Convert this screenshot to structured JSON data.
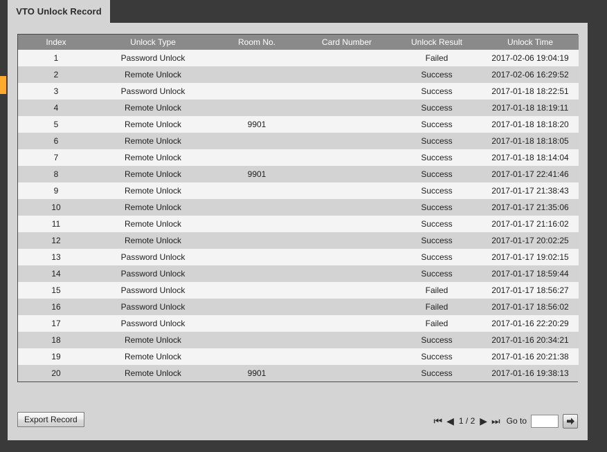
{
  "window": {
    "tab_label": "VTO Unlock Record"
  },
  "table": {
    "columns": [
      "Index",
      "Unlock Type",
      "Room No.",
      "Card Number",
      "Unlock Result",
      "Unlock Time"
    ],
    "rows": [
      {
        "index": "1",
        "unlock_type": "Password Unlock",
        "room_no": "",
        "card_number": "",
        "unlock_result": "Failed",
        "unlock_time": "2017-02-06 19:04:19"
      },
      {
        "index": "2",
        "unlock_type": "Remote Unlock",
        "room_no": "",
        "card_number": "",
        "unlock_result": "Success",
        "unlock_time": "2017-02-06 16:29:52"
      },
      {
        "index": "3",
        "unlock_type": "Password Unlock",
        "room_no": "",
        "card_number": "",
        "unlock_result": "Success",
        "unlock_time": "2017-01-18 18:22:51"
      },
      {
        "index": "4",
        "unlock_type": "Remote Unlock",
        "room_no": "",
        "card_number": "",
        "unlock_result": "Success",
        "unlock_time": "2017-01-18 18:19:11"
      },
      {
        "index": "5",
        "unlock_type": "Remote Unlock",
        "room_no": "9901",
        "card_number": "",
        "unlock_result": "Success",
        "unlock_time": "2017-01-18 18:18:20"
      },
      {
        "index": "6",
        "unlock_type": "Remote Unlock",
        "room_no": "",
        "card_number": "",
        "unlock_result": "Success",
        "unlock_time": "2017-01-18 18:18:05"
      },
      {
        "index": "7",
        "unlock_type": "Remote Unlock",
        "room_no": "",
        "card_number": "",
        "unlock_result": "Success",
        "unlock_time": "2017-01-18 18:14:04"
      },
      {
        "index": "8",
        "unlock_type": "Remote Unlock",
        "room_no": "9901",
        "card_number": "",
        "unlock_result": "Success",
        "unlock_time": "2017-01-17 22:41:46"
      },
      {
        "index": "9",
        "unlock_type": "Remote Unlock",
        "room_no": "",
        "card_number": "",
        "unlock_result": "Success",
        "unlock_time": "2017-01-17 21:38:43"
      },
      {
        "index": "10",
        "unlock_type": "Remote Unlock",
        "room_no": "",
        "card_number": "",
        "unlock_result": "Success",
        "unlock_time": "2017-01-17 21:35:06"
      },
      {
        "index": "11",
        "unlock_type": "Remote Unlock",
        "room_no": "",
        "card_number": "",
        "unlock_result": "Success",
        "unlock_time": "2017-01-17 21:16:02"
      },
      {
        "index": "12",
        "unlock_type": "Remote Unlock",
        "room_no": "",
        "card_number": "",
        "unlock_result": "Success",
        "unlock_time": "2017-01-17 20:02:25"
      },
      {
        "index": "13",
        "unlock_type": "Password Unlock",
        "room_no": "",
        "card_number": "",
        "unlock_result": "Success",
        "unlock_time": "2017-01-17 19:02:15"
      },
      {
        "index": "14",
        "unlock_type": "Password Unlock",
        "room_no": "",
        "card_number": "",
        "unlock_result": "Success",
        "unlock_time": "2017-01-17 18:59:44"
      },
      {
        "index": "15",
        "unlock_type": "Password Unlock",
        "room_no": "",
        "card_number": "",
        "unlock_result": "Failed",
        "unlock_time": "2017-01-17 18:56:27"
      },
      {
        "index": "16",
        "unlock_type": "Password Unlock",
        "room_no": "",
        "card_number": "",
        "unlock_result": "Failed",
        "unlock_time": "2017-01-17 18:56:02"
      },
      {
        "index": "17",
        "unlock_type": "Password Unlock",
        "room_no": "",
        "card_number": "",
        "unlock_result": "Failed",
        "unlock_time": "2017-01-16 22:20:29"
      },
      {
        "index": "18",
        "unlock_type": "Remote Unlock",
        "room_no": "",
        "card_number": "",
        "unlock_result": "Success",
        "unlock_time": "2017-01-16 20:34:21"
      },
      {
        "index": "19",
        "unlock_type": "Remote Unlock",
        "room_no": "",
        "card_number": "",
        "unlock_result": "Success",
        "unlock_time": "2017-01-16 20:21:38"
      },
      {
        "index": "20",
        "unlock_type": "Remote Unlock",
        "room_no": "9901",
        "card_number": "",
        "unlock_result": "Success",
        "unlock_time": "2017-01-16 19:38:13"
      }
    ]
  },
  "footer": {
    "export_label": "Export Record",
    "pager": {
      "first_icon": "⏮",
      "prev_icon": "◀",
      "page_info": "1 / 2",
      "next_icon": "▶",
      "last_icon": "⏭",
      "goto_label": "Go to",
      "goto_value": "",
      "goto_placeholder": ""
    }
  },
  "colors": {
    "chrome_dark": "#3a3a3a",
    "panel": "#d4d4d4",
    "header_row": "#8a8a8a",
    "row_odd": "#f4f4f4",
    "row_even": "#d3d3d3",
    "marker_orange": "#ffa92e"
  }
}
